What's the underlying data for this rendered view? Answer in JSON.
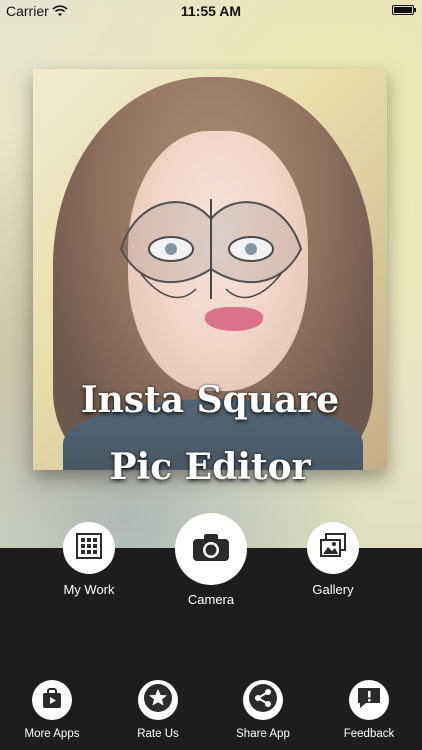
{
  "status_bar": {
    "carrier": "Carrier",
    "time": "11:55 AM"
  },
  "title": {
    "line1": "Insta Square",
    "line2": "Pic Editor"
  },
  "actions": {
    "my_work": "My Work",
    "camera": "Camera",
    "gallery": "Gallery"
  },
  "bottom_nav": {
    "more_apps": "More Apps",
    "rate_us": "Rate Us",
    "share_app": "Share App",
    "feedback": "Feedback"
  },
  "icons": {
    "my_work": "grid-icon",
    "camera": "camera-icon",
    "gallery": "gallery-icon",
    "more_apps": "store-bag-icon",
    "rate_us": "star-icon",
    "share_app": "share-icon",
    "feedback": "feedback-icon"
  },
  "colors": {
    "bottom_background": "#1d1d1d",
    "button_fill": "#ffffff",
    "icon_color": "#2b2b2b"
  }
}
